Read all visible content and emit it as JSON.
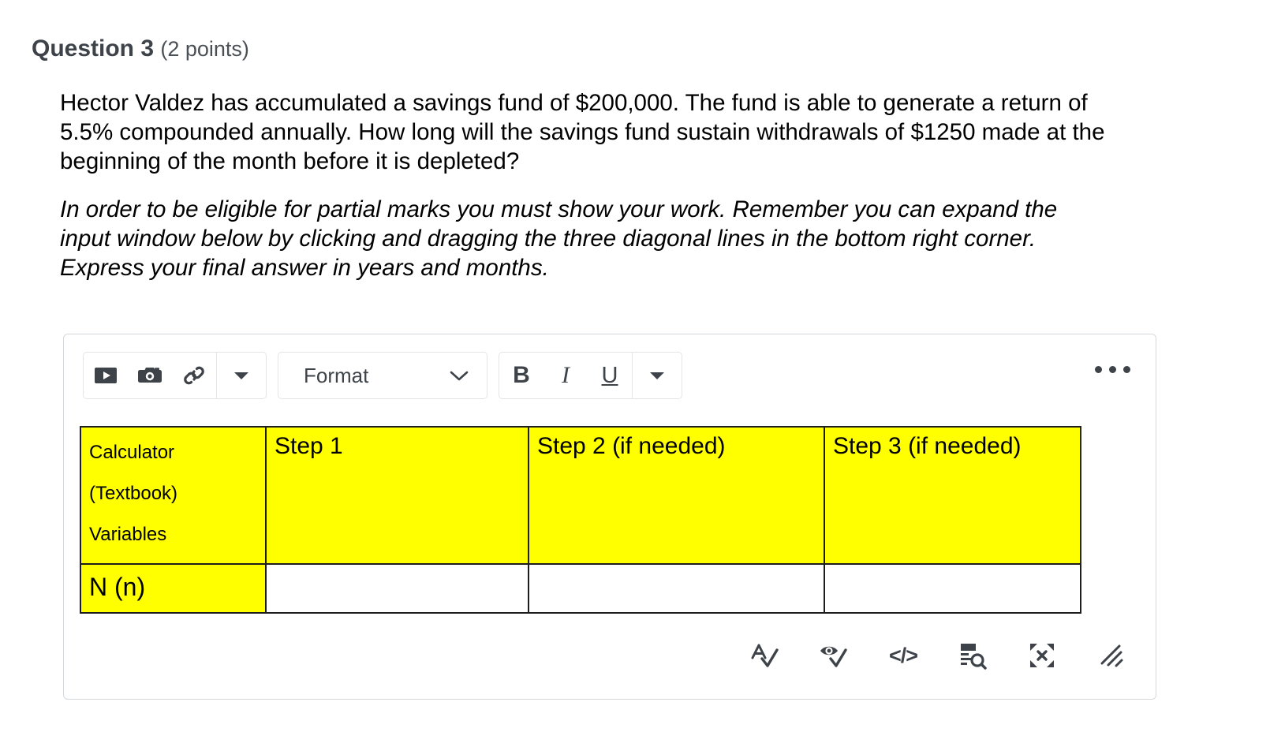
{
  "question": {
    "title": "Question 3",
    "points": "(2 points)",
    "paragraphs": [
      "Hector Valdez has accumulated a savings fund of $200,000. The fund is able to generate a return of 5.5% compounded annually. How long will the savings fund sustain withdrawals of $1250 made at the beginning of the month before it is depleted?",
      "In order to be eligible for partial marks you must show your work. Remember you can expand the input window below by clicking and dragging the three diagonal lines in the bottom right corner.  Express your final answer in years and months."
    ]
  },
  "editor": {
    "toolbar": {
      "insert_group": [
        {
          "name": "video-icon",
          "label": "Insert video"
        },
        {
          "name": "camera-icon",
          "label": "Insert image"
        },
        {
          "name": "link-icon",
          "label": "Insert link"
        }
      ],
      "insert_more_label": "More insert options",
      "format_select": {
        "value": "Format",
        "placeholder": "Format"
      },
      "style_group": [
        {
          "name": "bold-button",
          "label": "B"
        },
        {
          "name": "italic-button",
          "label": "I"
        },
        {
          "name": "underline-button",
          "label": "U"
        }
      ],
      "style_more_label": "More text options",
      "overflow_label": "More toolbar options"
    },
    "statusbar": [
      {
        "name": "spellcheck-icon",
        "label": "Check accessibility spelling"
      },
      {
        "name": "accessibility-eye-icon",
        "label": "Accessibility checker"
      },
      {
        "name": "html-source-icon",
        "label": "</>"
      },
      {
        "name": "word-count-icon",
        "label": "Word count"
      },
      {
        "name": "fullscreen-icon",
        "label": "Fullscreen"
      },
      {
        "name": "resize-handle-icon",
        "label": "Resize"
      }
    ],
    "table": {
      "headers": [
        [
          "Calculator",
          "(Textbook)",
          "Variables"
        ],
        [
          "Step 1"
        ],
        [
          "Step 2 (if needed)"
        ],
        [
          "Step 3 (if needed)"
        ]
      ],
      "rows": [
        {
          "label": "N (n)",
          "cells": [
            "",
            "",
            ""
          ]
        },
        {
          "label": "",
          "cells": [
            "",
            "",
            ""
          ]
        }
      ],
      "highlight_color": "#ffff00"
    }
  }
}
